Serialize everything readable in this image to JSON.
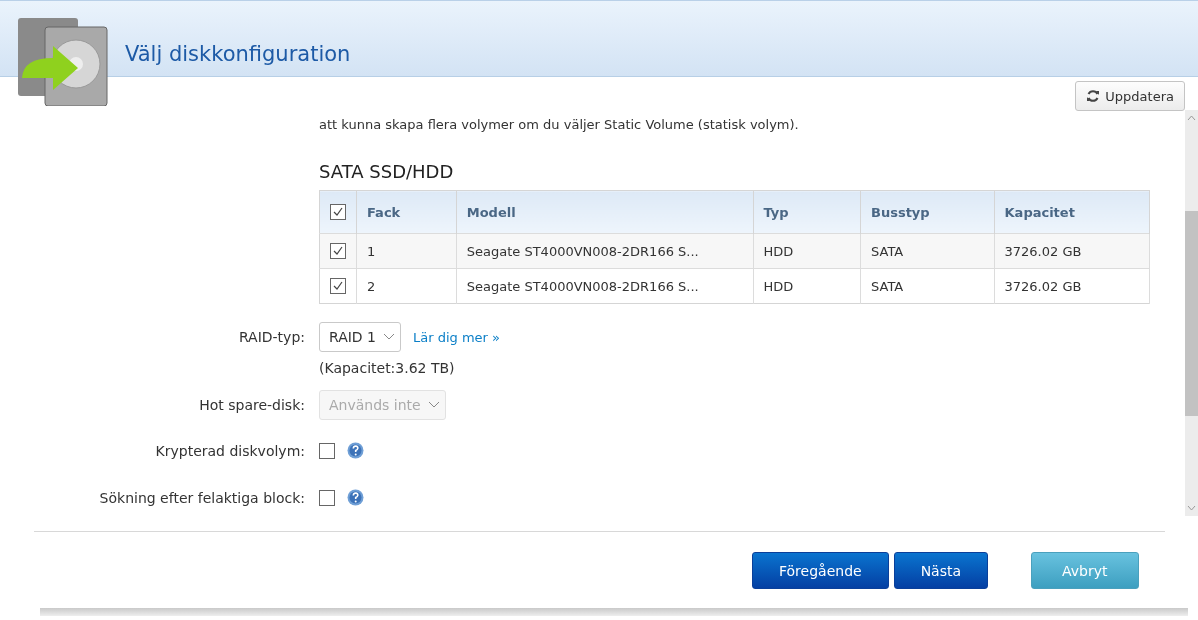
{
  "window": {
    "title": "Välj diskkonfiguration"
  },
  "refresh_button": {
    "label": "Uppdatera"
  },
  "description": "att kunna skapa flera volymer om du väljer Static Volume (statisk volym).",
  "section_title": "SATA SSD/HDD",
  "table": {
    "select_all": {
      "checked": true
    },
    "columns": [
      "Fack",
      "Modell",
      "Typ",
      "Busstyp",
      "Kapacitet"
    ],
    "rows": [
      {
        "checked": true,
        "cells": [
          "1",
          "Seagate ST4000VN008-2DR166 S...",
          "HDD",
          "SATA",
          "3726.02 GB"
        ]
      },
      {
        "checked": true,
        "cells": [
          "2",
          "Seagate ST4000VN008-2DR166 S...",
          "HDD",
          "SATA",
          "3726.02 GB"
        ]
      }
    ]
  },
  "form": [
    {
      "kind": "select",
      "label": "RAID-typ:",
      "value": "RAID 1",
      "disabled": false,
      "link": "Lär dig mer »",
      "note": "(Kapacitet:3.62 TB)"
    },
    {
      "kind": "select",
      "label": "Hot spare-disk:",
      "value": "Används inte",
      "disabled": true
    },
    {
      "kind": "checkbox",
      "label": "Krypterad diskvolym:",
      "checked": false
    },
    {
      "kind": "checkbox",
      "label": "Sökning efter felaktiga block:",
      "checked": false
    }
  ],
  "buttons": [
    {
      "label": "Föregående",
      "kind": "primary"
    },
    {
      "label": "Nästa",
      "kind": "primary"
    },
    {
      "label": "Avbryt",
      "kind": "secondary"
    }
  ]
}
